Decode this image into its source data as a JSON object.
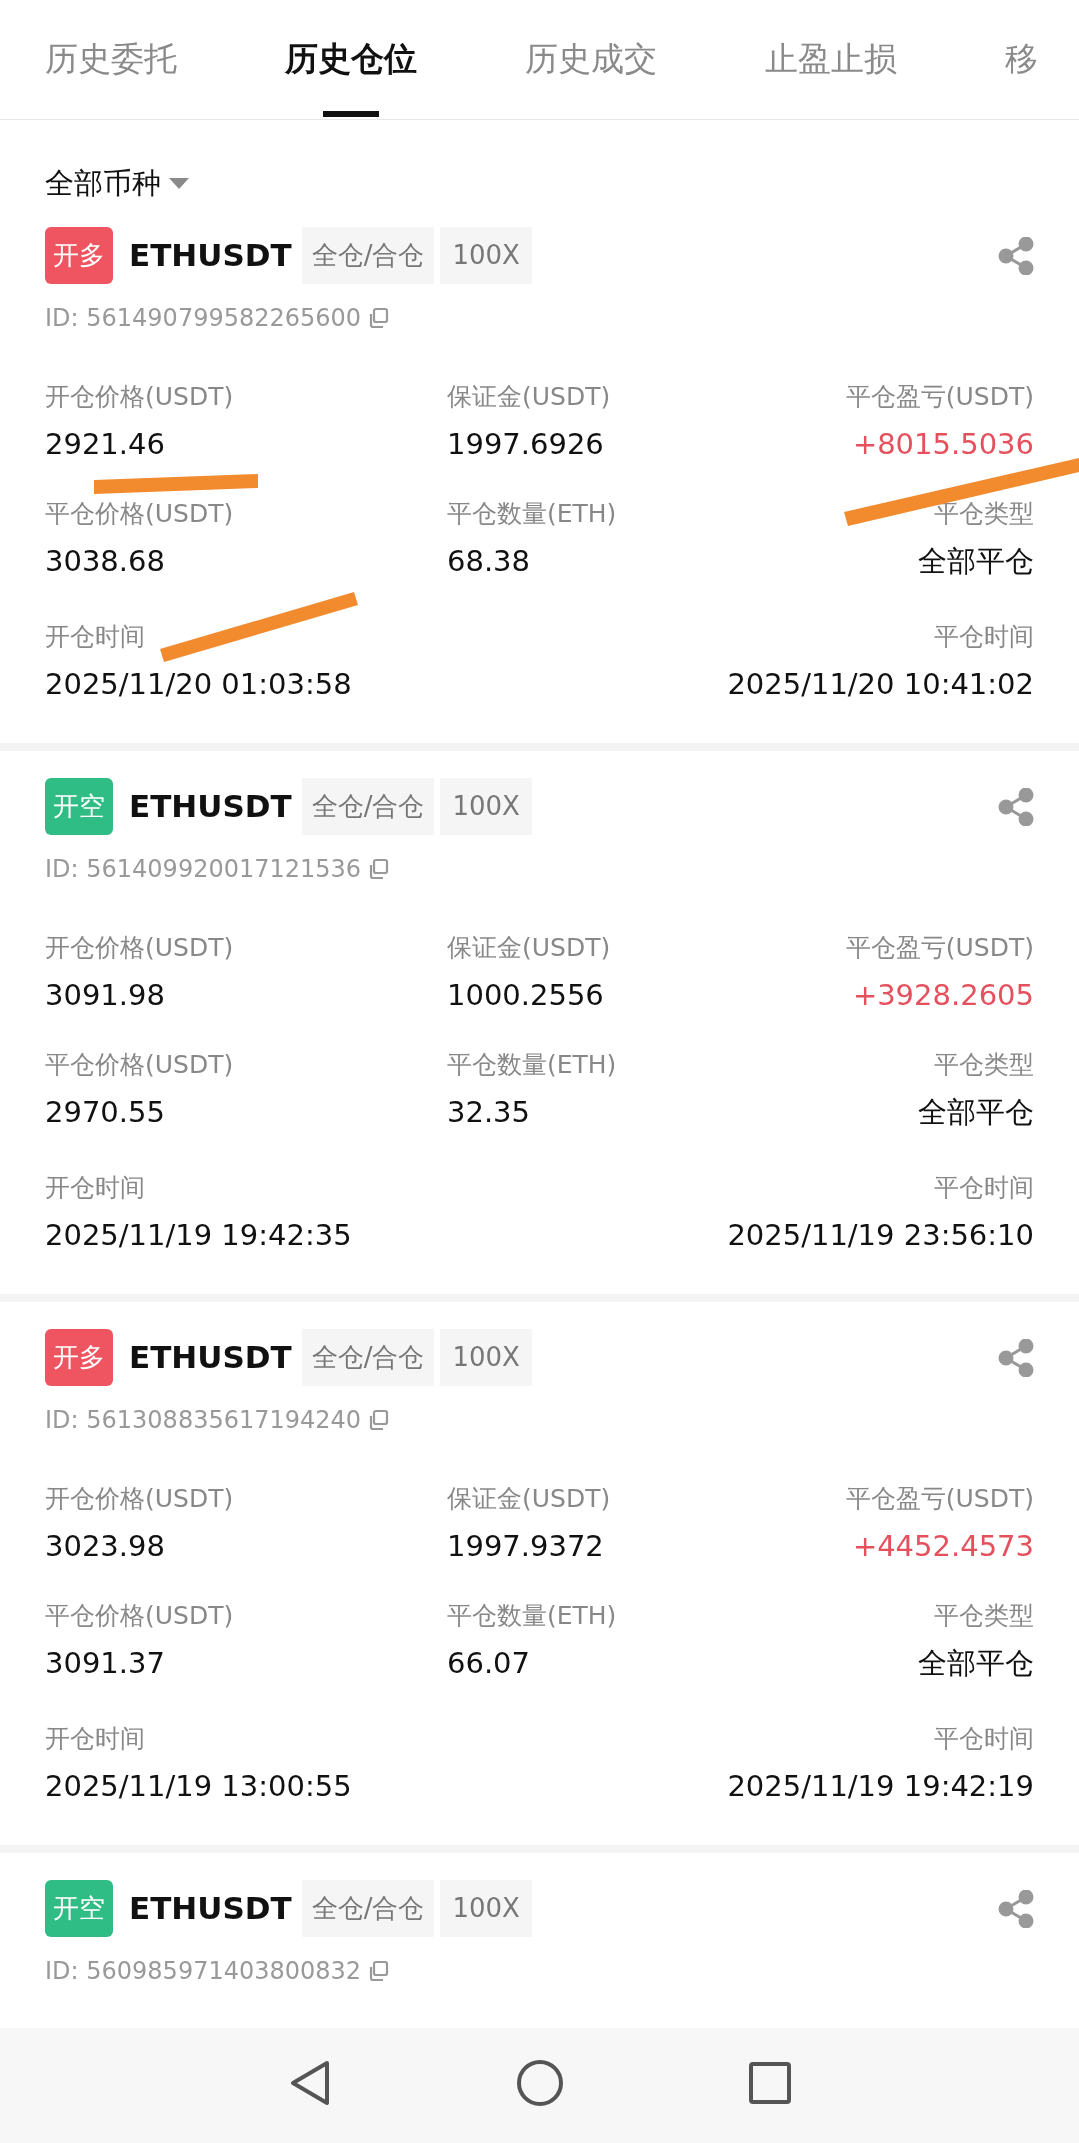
{
  "tabs": [
    {
      "label": "历史委托",
      "selected": false
    },
    {
      "label": "历史仓位",
      "selected": true
    },
    {
      "label": "历史成交",
      "selected": false
    },
    {
      "label": "止盈止损",
      "selected": false
    },
    {
      "label": "移",
      "selected": false
    }
  ],
  "filter": {
    "label": "全部币种"
  },
  "positions": [
    {
      "kind": "long",
      "side_label": "开多",
      "symbol": "ETHUSDT",
      "margin_mode": "全仓/合仓",
      "leverage": "100X",
      "id": "ID: 561490799582265600",
      "fields": [
        {
          "label": "开仓价格(USDT)",
          "value": "2921.46"
        },
        {
          "label": "保证金(USDT)",
          "value": "1997.6926"
        },
        {
          "label": "平仓盈亏(USDT)",
          "value": "+8015.5036",
          "kind": "profit"
        },
        {
          "label": "平仓价格(USDT)",
          "value": "3038.68"
        },
        {
          "label": "平仓数量(ETH)",
          "value": "68.38"
        },
        {
          "label": "平仓类型",
          "value": "全部平仓"
        }
      ],
      "open_time": {
        "label": "开仓时间",
        "value": "2025/11/20 01:03:58"
      },
      "close_time": {
        "label": "平仓时间",
        "value": "2025/11/20 10:41:02"
      }
    },
    {
      "kind": "short",
      "side_label": "开空",
      "symbol": "ETHUSDT",
      "margin_mode": "全仓/合仓",
      "leverage": "100X",
      "id": "ID: 561409920017121536",
      "fields": [
        {
          "label": "开仓价格(USDT)",
          "value": "3091.98"
        },
        {
          "label": "保证金(USDT)",
          "value": "1000.2556"
        },
        {
          "label": "平仓盈亏(USDT)",
          "value": "+3928.2605",
          "kind": "profit"
        },
        {
          "label": "平仓价格(USDT)",
          "value": "2970.55"
        },
        {
          "label": "平仓数量(ETH)",
          "value": "32.35"
        },
        {
          "label": "平仓类型",
          "value": "全部平仓"
        }
      ],
      "open_time": {
        "label": "开仓时间",
        "value": "2025/11/19 19:42:35"
      },
      "close_time": {
        "label": "平仓时间",
        "value": "2025/11/19 23:56:10"
      }
    },
    {
      "kind": "long",
      "side_label": "开多",
      "symbol": "ETHUSDT",
      "margin_mode": "全仓/合仓",
      "leverage": "100X",
      "id": "ID: 561308835617194240",
      "fields": [
        {
          "label": "开仓价格(USDT)",
          "value": "3023.98"
        },
        {
          "label": "保证金(USDT)",
          "value": "1997.9372"
        },
        {
          "label": "平仓盈亏(USDT)",
          "value": "+4452.4573",
          "kind": "profit"
        },
        {
          "label": "平仓价格(USDT)",
          "value": "3091.37"
        },
        {
          "label": "平仓数量(ETH)",
          "value": "66.07"
        },
        {
          "label": "平仓类型",
          "value": "全部平仓"
        }
      ],
      "open_time": {
        "label": "开仓时间",
        "value": "2025/11/19 13:00:55"
      },
      "close_time": {
        "label": "平仓时间",
        "value": "2025/11/19 19:42:19"
      }
    },
    {
      "kind": "short",
      "side_label": "开空",
      "symbol": "ETHUSDT",
      "margin_mode": "全仓/合仓",
      "leverage": "100X",
      "id": "ID: 560985971403800832"
    }
  ]
}
